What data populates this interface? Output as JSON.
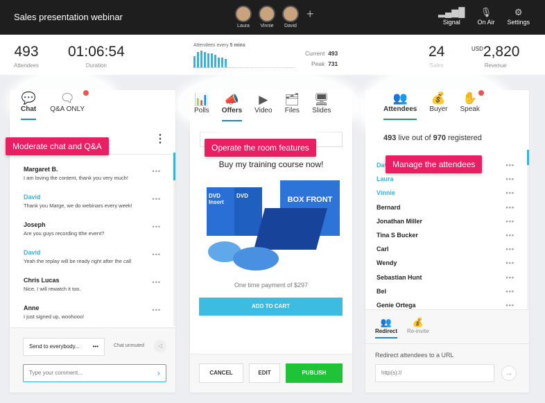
{
  "header": {
    "title": "Sales presentation webinar",
    "presenters": [
      "Laura",
      "Vinnie",
      "David"
    ],
    "add": "+",
    "tools": [
      {
        "icon": "signal-icon",
        "label": "Signal"
      },
      {
        "icon": "microphone-icon",
        "label": "On Air"
      },
      {
        "icon": "gear-icon",
        "label": "Settings"
      }
    ]
  },
  "stats": {
    "attendees": "493",
    "attendees_label": "Attendees",
    "duration": "01:06:54",
    "duration_label": "Duration",
    "graph_caption": "Attendees every",
    "graph_interval": "5 mins",
    "graph_values": [
      8,
      11,
      12,
      11,
      10,
      10,
      9,
      7,
      7,
      6
    ],
    "current_label": "Current",
    "current": "493",
    "peak_label": "Peak",
    "peak": "731",
    "sales": "24",
    "sales_label": "Sales",
    "currency": "USD",
    "revenue": "2,820",
    "revenue_label": "Revenue"
  },
  "chat": {
    "tabs": [
      {
        "label": "Chat",
        "icon": "chat-icon"
      },
      {
        "label": "Q&A ONLY",
        "icon": "qa-icon"
      }
    ],
    "callout": "Moderate chat and Q&A",
    "messages": [
      {
        "name": "Margaret B.",
        "text": "I am loving the content, thank you very much!",
        "host": false
      },
      {
        "name": "David",
        "text": "Thank you Marge, we do webinars every week!",
        "host": true
      },
      {
        "name": "Joseph",
        "text": "Are you guys recording tthe event?",
        "host": false
      },
      {
        "name": "David",
        "text": "Yeah the replay will be ready right after the call",
        "host": true
      },
      {
        "name": "Chris Lucas",
        "text": "Nice, I will rewatch it too.",
        "host": false
      },
      {
        "name": "Anne",
        "text": "I just signed up, woohooo!",
        "host": false
      }
    ],
    "send_to": "Send to everybody...",
    "chat_status": "Chat unmuted",
    "comment_placeholder": "Type your comment..."
  },
  "room": {
    "tabs": [
      {
        "label": "Polls",
        "icon": "poll-icon"
      },
      {
        "label": "Offers",
        "icon": "megaphone-icon"
      },
      {
        "label": "Video",
        "icon": "video-icon"
      },
      {
        "label": "Files",
        "icon": "files-icon"
      },
      {
        "label": "Slides",
        "icon": "slides-icon"
      }
    ],
    "callout": "Operate the room features",
    "offer_title": "Buy my training course now!",
    "payment": "One time payment of $297",
    "add_to_cart": "ADD TO CART",
    "cancel": "CANCEL",
    "edit": "EDIT",
    "publish": "PUBLISH",
    "box_text": "BOX FRONT",
    "dvd_text": "DVD Insert"
  },
  "people": {
    "tabs": [
      {
        "label": "Attendees",
        "icon": "attendees-icon"
      },
      {
        "label": "Buyer",
        "icon": "money-bag-icon"
      },
      {
        "label": "Speak",
        "icon": "raise-hand-icon"
      }
    ],
    "live": "493",
    "live_mid": "live out of",
    "registered": "970",
    "registered_label": "registered",
    "callout": "Manage the attendees",
    "attendees": [
      {
        "name": "David",
        "host": true
      },
      {
        "name": "Laura",
        "host": true
      },
      {
        "name": "Vinnie",
        "host": true
      },
      {
        "name": "Bernard",
        "host": false
      },
      {
        "name": "Jonathan Miller",
        "host": false
      },
      {
        "name": "Tina S Bucker",
        "host": false
      },
      {
        "name": "Carl",
        "host": false
      },
      {
        "name": "Wendy",
        "host": false
      },
      {
        "name": "Sebastian Hunt",
        "host": false
      },
      {
        "name": "Bel",
        "host": false
      },
      {
        "name": "Genie Ortega",
        "host": false
      }
    ],
    "redirect_tab": "Redirect",
    "reinvite_tab": "Re-invite",
    "redirect_label": "Redirect attendees to a URL",
    "url_placeholder": "http(s)://"
  },
  "colors": {
    "accent": "#3bb1d8",
    "callout": "#e91e63",
    "publish": "#1ec337",
    "header": "#1e1e1e"
  }
}
